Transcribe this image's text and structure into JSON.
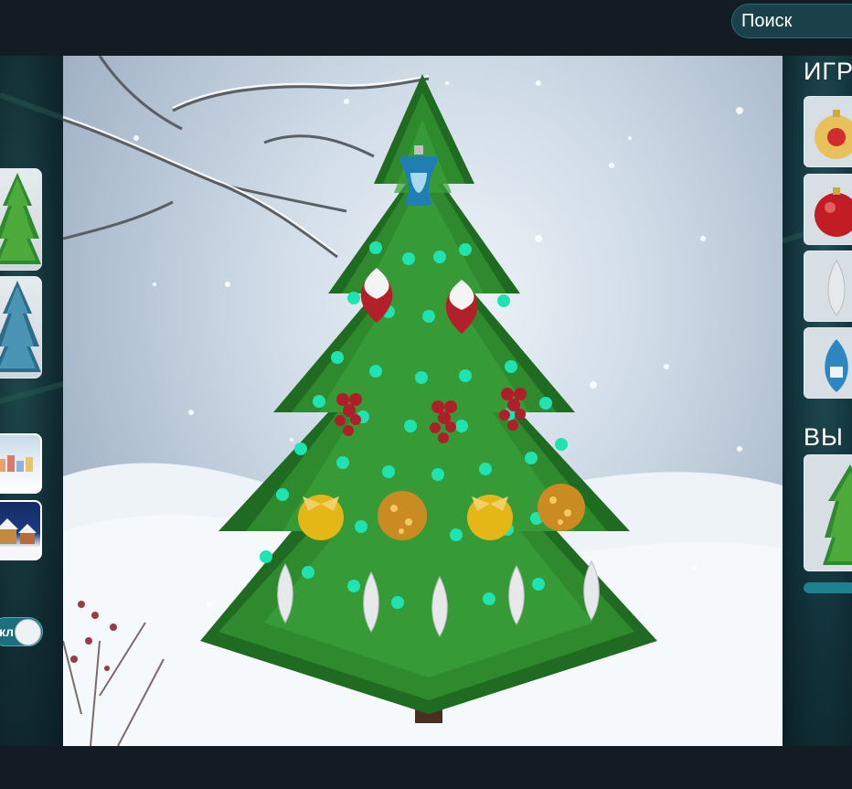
{
  "header": {
    "search_placeholder": "Поиск"
  },
  "left_panel": {
    "toggle_label": "кл"
  },
  "right_panel": {
    "toys_heading": "ИГРУ",
    "selected_heading": "ВЫ Н"
  },
  "colors": {
    "background": "#131b24",
    "accent": "#1c6f7c",
    "garland_light": "#20e3b2"
  },
  "icons": {
    "ornament_names": [
      "bell-ornament-icon",
      "snow-cap-ornament-icon",
      "grape-ornament-icon",
      "gold-bow-ball-icon",
      "gold-sequin-ball-icon",
      "silver-cone-ornament-icon"
    ]
  }
}
